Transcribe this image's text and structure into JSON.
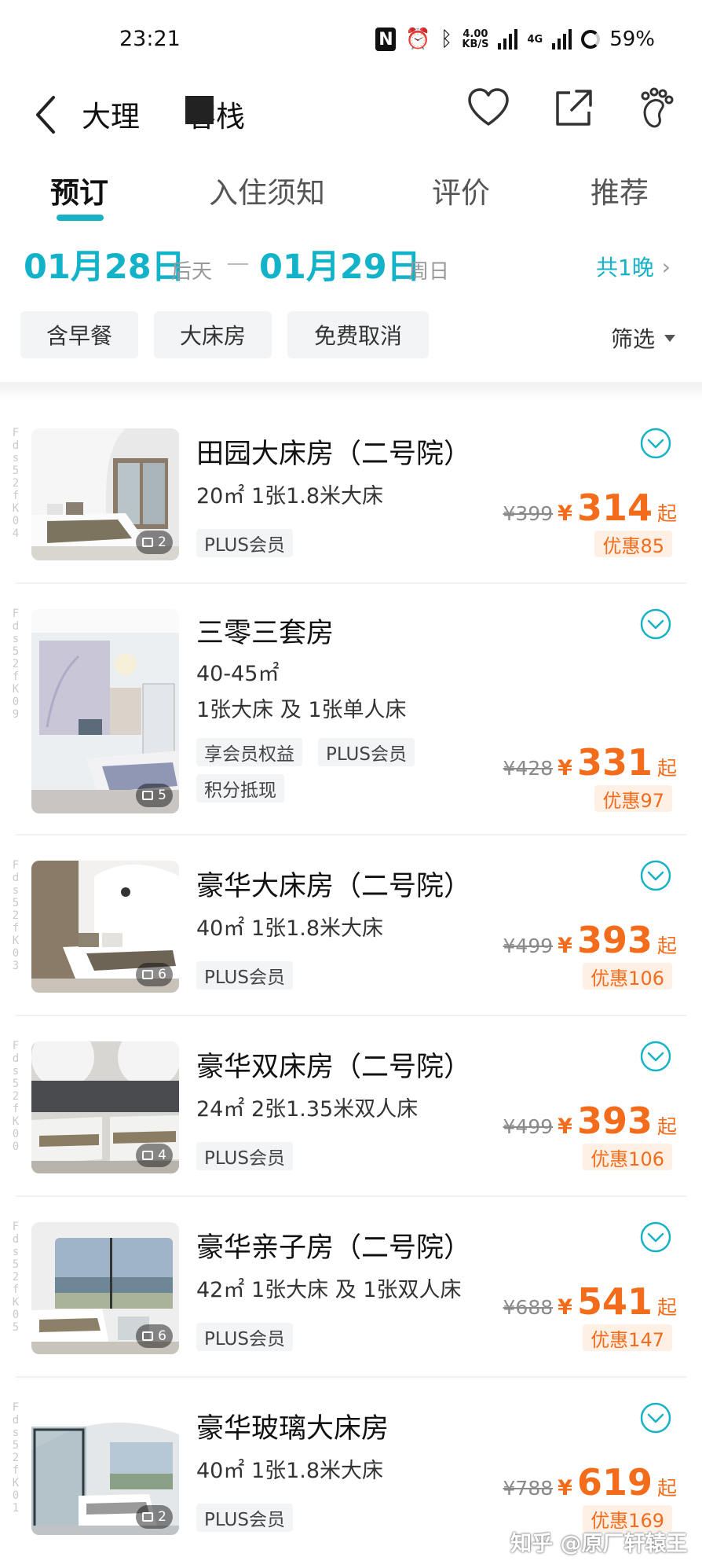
{
  "status_bar": {
    "time": "23:21",
    "net_speed_top": "4.00",
    "net_speed_bottom": "KB/S",
    "net_type": "4G",
    "battery": "59%"
  },
  "header": {
    "hotel_name_left": "大理",
    "hotel_name_right": "客栈"
  },
  "tabs": [
    "预订",
    "入住须知",
    "评价",
    "推荐"
  ],
  "dates": {
    "checkin": "01月28日",
    "checkin_day": "后天",
    "checkout": "01月29日",
    "checkout_day": "周日",
    "nights": "共1晚"
  },
  "filters": {
    "chips": [
      "含早餐",
      "大床房",
      "免费取消"
    ],
    "filter_label": "筛选"
  },
  "colors": {
    "accent": "#12b3c8",
    "price": "#f36c1b"
  },
  "rooms": [
    {
      "name": "田园大床房（二号院）",
      "specs": [
        "20㎡   1张1.8米大床"
      ],
      "tags": [
        "PLUS会员"
      ],
      "image_count": "2",
      "orig_price": "¥399",
      "currency": "¥",
      "price": "314",
      "suffix": "起",
      "discount": "优惠85",
      "side_code": "Fds52fK04"
    },
    {
      "name": "三零三套房",
      "specs": [
        "40-45㎡",
        "1张大床 及 1张单人床"
      ],
      "tags": [
        "享会员权益",
        "PLUS会员",
        "积分抵现"
      ],
      "image_count": "5",
      "orig_price": "¥428",
      "currency": "¥",
      "price": "331",
      "suffix": "起",
      "discount": "优惠97",
      "side_code": "Fds52fK09"
    },
    {
      "name": "豪华大床房（二号院）",
      "specs": [
        "40㎡   1张1.8米大床"
      ],
      "tags": [
        "PLUS会员"
      ],
      "image_count": "6",
      "orig_price": "¥499",
      "currency": "¥",
      "price": "393",
      "suffix": "起",
      "discount": "优惠106",
      "side_code": "Fds52fK03"
    },
    {
      "name": "豪华双床房（二号院）",
      "specs": [
        "24㎡   2张1.35米双人床"
      ],
      "tags": [
        "PLUS会员"
      ],
      "image_count": "4",
      "orig_price": "¥499",
      "currency": "¥",
      "price": "393",
      "suffix": "起",
      "discount": "优惠106",
      "side_code": "Fds52fK00"
    },
    {
      "name": "豪华亲子房（二号院）",
      "specs": [
        "42㎡   1张大床 及 1张双人床"
      ],
      "tags": [
        "PLUS会员"
      ],
      "image_count": "6",
      "orig_price": "¥688",
      "currency": "¥",
      "price": "541",
      "suffix": "起",
      "discount": "优惠147",
      "side_code": "Fds52fK05"
    },
    {
      "name": "豪华玻璃大床房",
      "specs": [
        "40㎡   1张1.8米大床"
      ],
      "tags": [
        "PLUS会员"
      ],
      "image_count": "2",
      "orig_price": "¥788",
      "currency": "¥",
      "price": "619",
      "suffix": "起",
      "discount": "优惠169",
      "side_code": "Fds52fK01"
    }
  ],
  "watermark": "知乎 @原厂轩辕王"
}
